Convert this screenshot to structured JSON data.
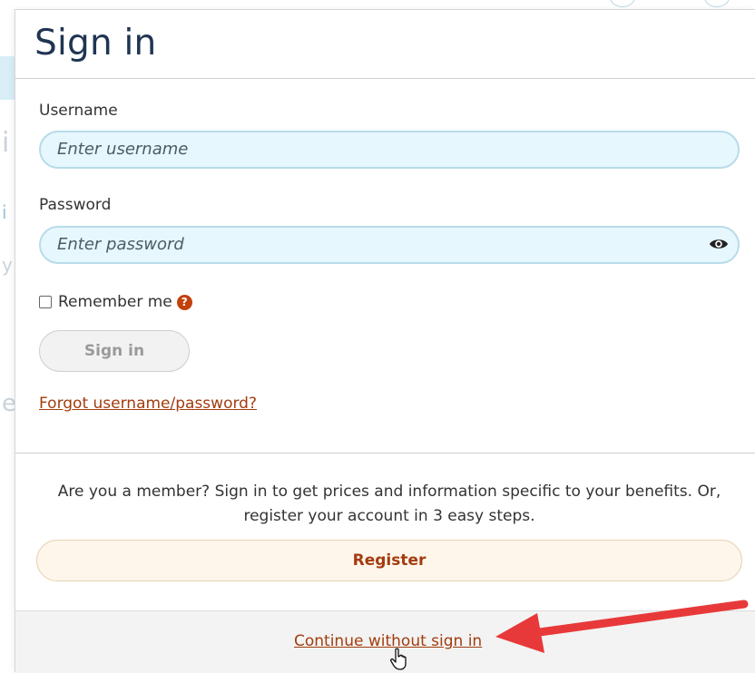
{
  "modal": {
    "title": "Sign in",
    "username": {
      "label": "Username",
      "placeholder": "Enter username"
    },
    "password": {
      "label": "Password",
      "placeholder": "Enter password"
    },
    "remember_label": "Remember me",
    "signin_label": "Sign in",
    "forgot_label": "Forgot username/password?",
    "member_text_line1": "Are you a member? Sign in to get prices and information specific to your benefits. Or,",
    "member_text_line2": "register your account in 3 easy steps.",
    "register_label": "Register",
    "continue_label": "Continue without sign in"
  },
  "colors": {
    "title": "#1f3552",
    "link": "#a23d0e",
    "input_bg": "#e6f7fd",
    "input_border": "#b8dbe8",
    "register_bg": "#fef6ea",
    "arrow": "#e8393a",
    "help_icon": "#c2410c"
  },
  "icons": {
    "password_toggle": "eye-icon",
    "help": "question-circle-icon",
    "cursor": "hand-pointer-icon",
    "annotation": "red-arrow-icon"
  }
}
